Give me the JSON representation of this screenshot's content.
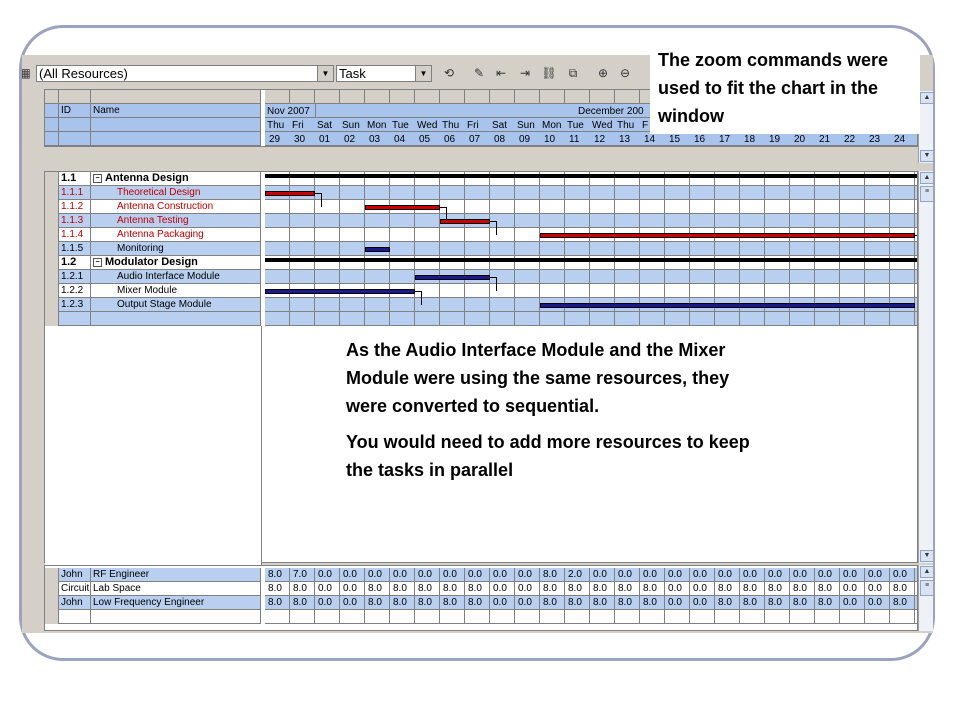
{
  "toolbar": {
    "resource_filter": "(All Resources)",
    "view_mode": "Task",
    "icons": [
      "refresh-icon",
      "properties-icon",
      "outdent-icon",
      "indent-icon",
      "link-icon",
      "unlink-icon",
      "zoom-in-icon",
      "zoom-out-icon"
    ]
  },
  "task_header": {
    "id_label": "ID",
    "name_label": "Name"
  },
  "timeline": {
    "month1": "Nov 2007",
    "month2": "December 200",
    "days": [
      "Thu",
      "Fri",
      "Sat",
      "Sun",
      "Mon",
      "Tue",
      "Wed",
      "Thu",
      "Fri",
      "Sat",
      "Sun",
      "Mon",
      "Tue",
      "Wed",
      "Thu",
      "F"
    ],
    "dates": [
      "29",
      "30",
      "01",
      "02",
      "03",
      "04",
      "05",
      "06",
      "07",
      "08",
      "09",
      "10",
      "11",
      "12",
      "13",
      "14",
      "15",
      "16",
      "17",
      "18",
      "19",
      "20",
      "21",
      "22",
      "23",
      "24"
    ]
  },
  "tasks": [
    {
      "id": "1.1",
      "name": "Antenna Design",
      "summary": true
    },
    {
      "id": "1.1.1",
      "name": "Theoretical Design",
      "red": true
    },
    {
      "id": "1.1.2",
      "name": "Antenna Construction",
      "red": true
    },
    {
      "id": "1.1.3",
      "name": "Antenna Testing",
      "red": true
    },
    {
      "id": "1.1.4",
      "name": "Antenna Packaging",
      "red": true
    },
    {
      "id": "1.1.5",
      "name": "Monitoring"
    },
    {
      "id": "1.2",
      "name": "Modulator Design",
      "summary": true
    },
    {
      "id": "1.2.1",
      "name": "Audio Interface Module"
    },
    {
      "id": "1.2.2",
      "name": "Mixer Module"
    },
    {
      "id": "1.2.3",
      "name": "Output Stage Module"
    }
  ],
  "bars": [
    {
      "row": 1,
      "start": 0,
      "end": 2,
      "color": "#cc0000"
    },
    {
      "row": 2,
      "start": 4,
      "end": 7,
      "color": "#cc0000"
    },
    {
      "row": 3,
      "start": 7,
      "end": 9,
      "color": "#cc0000"
    },
    {
      "row": 4,
      "start": 11,
      "end": 26,
      "color": "#cc0000"
    },
    {
      "row": 5,
      "start": 4,
      "end": 5,
      "color": "#1a1a8c"
    },
    {
      "row": 7,
      "start": 6,
      "end": 9,
      "color": "#1a1a8c"
    },
    {
      "row": 8,
      "start": 0,
      "end": 6,
      "color": "#1a1a8c"
    },
    {
      "row": 9,
      "start": 11,
      "end": 26,
      "color": "#1a1a8c"
    }
  ],
  "resources": [
    {
      "who": "John",
      "role": "RF Engineer",
      "values": [
        "8.0",
        "7.0",
        "0.0",
        "0.0",
        "0.0",
        "0.0",
        "0.0",
        "0.0",
        "0.0",
        "0.0",
        "0.0",
        "8.0",
        "2.0",
        "0.0",
        "0.0",
        "0.0",
        "0.0",
        "0.0",
        "0.0",
        "0.0",
        "0.0",
        "0.0",
        "0.0",
        "0.0",
        "0.0",
        "0.0"
      ]
    },
    {
      "who": "Circuit",
      "role": "Lab Space",
      "values": [
        "8.0",
        "8.0",
        "0.0",
        "0.0",
        "8.0",
        "8.0",
        "8.0",
        "8.0",
        "8.0",
        "0.0",
        "0.0",
        "8.0",
        "8.0",
        "8.0",
        "8.0",
        "8.0",
        "0.0",
        "0.0",
        "8.0",
        "8.0",
        "8.0",
        "8.0",
        "8.0",
        "0.0",
        "0.0",
        "8.0"
      ]
    },
    {
      "who": "John",
      "role": "Low Frequency Engineer",
      "values": [
        "8.0",
        "8.0",
        "0.0",
        "0.0",
        "8.0",
        "8.0",
        "8.0",
        "8.0",
        "8.0",
        "0.0",
        "0.0",
        "8.0",
        "8.0",
        "8.0",
        "8.0",
        "8.0",
        "0.0",
        "0.0",
        "8.0",
        "8.0",
        "8.0",
        "8.0",
        "8.0",
        "0.0",
        "0.0",
        "8.0"
      ]
    }
  ],
  "callouts": {
    "zoom": "The zoom commands were used to fit the chart in the window",
    "sequential": "As the Audio Interface Module and the Mixer Module were using the same resources, they were converted to sequential.",
    "parallel": "You would need to add more resources to keep the tasks in parallel"
  },
  "colors": {
    "critical": "#cc0000",
    "normal": "#1a1a8c",
    "highlight": "#b8cff0",
    "header": "#a8c4ec"
  }
}
